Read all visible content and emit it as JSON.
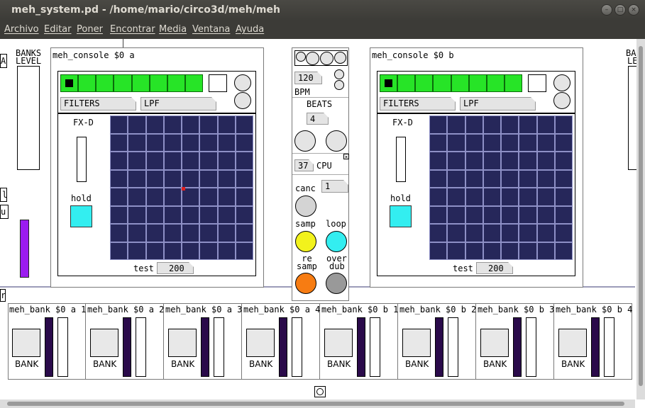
{
  "window": {
    "title": "meh_system.pd  - /home/mario/circo3d/meh/meh",
    "buttons": [
      "–",
      "□",
      "×"
    ]
  },
  "menu": [
    "Archivo",
    "Editar",
    "Poner",
    "Encontrar",
    "Media",
    "Ventana",
    "Ayuda"
  ],
  "left_partial": {
    "a_label": "A",
    "banks_level": [
      "BANKS",
      "LEVEL"
    ],
    "l_label": "l",
    "u_label": "u",
    "r_label": "r"
  },
  "right_partial": {
    "ba_label": "BA",
    "le_label": "LE"
  },
  "consoles": [
    {
      "title": "meh_console $0 a",
      "filters": "FILTERS",
      "lpf": "LPF",
      "fxd": "FX-D",
      "hold": "hold",
      "test": "test",
      "test_value": "200"
    },
    {
      "title": "meh_console $0 b",
      "filters": "FILTERS",
      "lpf": "LPF",
      "fxd": "FX-D",
      "hold": "hold",
      "test": "test",
      "test_value": "200"
    }
  ],
  "center": {
    "bpm_value": "120",
    "bpm_label": "BPM",
    "beats_label": "BEATS",
    "beats_value": "4",
    "cpu_value": "37",
    "cpu_label": "CPU",
    "canc_label": "canc",
    "canc_value": "1",
    "samp_label": "samp",
    "loop_label": "loop",
    "resamp_label": [
      "re",
      "samp"
    ],
    "overdub_label": [
      "over",
      "dub"
    ]
  },
  "banks": [
    {
      "title": "meh_bank $0 a 1",
      "label": "BANK"
    },
    {
      "title": "meh_bank $0 a 2",
      "label": "BANK"
    },
    {
      "title": "meh_bank $0 a 3",
      "label": "BANK"
    },
    {
      "title": "meh_bank $0 a 4",
      "label": "BANK"
    },
    {
      "title": "meh_bank $0 b 1",
      "label": "BANK"
    },
    {
      "title": "meh_bank $0 b 2",
      "label": "BANK"
    },
    {
      "title": "meh_bank $0 b 3",
      "label": "BANK"
    },
    {
      "title": "meh_bank $0 b 4",
      "label": "BANK"
    }
  ],
  "colors": {
    "grid": "#26275a",
    "meter_green": "#27e427",
    "cyan": "#33eef0",
    "yellow": "#f2f21c",
    "orange": "#f77c12",
    "gray": "#999999",
    "purple": "#9b1cf0",
    "dark_purple": "#2a0a4a"
  }
}
